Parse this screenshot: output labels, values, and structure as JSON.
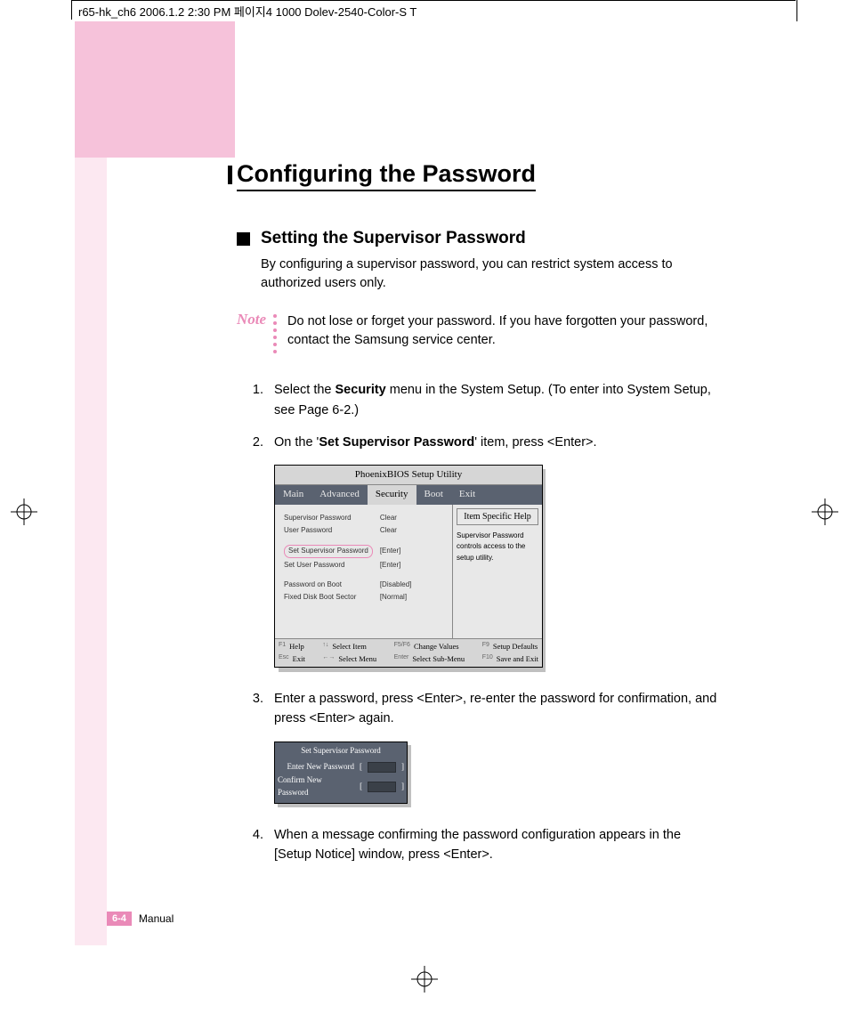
{
  "header": "r65-hk_ch6  2006.1.2 2:30 PM  페이지4   1000 Dolev-2540-Color-S  T",
  "title": "Configuring the Password",
  "section": {
    "title": "Setting the Supervisor Password",
    "body": "By configuring a supervisor password, you can restrict system access to authorized users only."
  },
  "note": {
    "label": "Note",
    "text": "Do not lose or forget your password. If you have forgotten your password, contact the Samsung service center."
  },
  "steps": [
    {
      "num": "1.",
      "pre": "Select the ",
      "bold": "Security",
      "post": " menu in the System Setup. (To enter into System Setup, see Page 6-2.)"
    },
    {
      "num": "2.",
      "pre": "On the '",
      "bold": "Set Supervisor Password",
      "post": "' item, press <Enter>."
    },
    {
      "num": "3.",
      "pre": "",
      "bold": "",
      "post": "Enter a password, press <Enter>, re-enter the password for confirmation, and press <Enter> again."
    },
    {
      "num": "4.",
      "pre": "",
      "bold": "",
      "post": "When a message confirming the password configuration appears in the [Setup Notice] window, press <Enter>."
    }
  ],
  "bios": {
    "title": "PhoenixBIOS  Setup Utility",
    "menu": [
      "Main",
      "Advanced",
      "Security",
      "Boot",
      "Exit"
    ],
    "active_menu": "Security",
    "rows": [
      {
        "label": "Supervisor Password",
        "value": "Clear"
      },
      {
        "label": "User Password",
        "value": "Clear"
      }
    ],
    "rows2": [
      {
        "label": "Set Supervisor Password",
        "value": "[Enter]",
        "highlight": true
      },
      {
        "label": "Set User Password",
        "value": "[Enter]"
      }
    ],
    "rows3": [
      {
        "label": "Password on Boot",
        "value": "[Disabled]"
      },
      {
        "label": "Fixed Disk Boot Sector",
        "value": "[Normal]"
      }
    ],
    "help_title": "Item Specific Help",
    "help_text": "Supervisor Password controls access to the setup utility.",
    "footer": {
      "c1": [
        {
          "k": "F1",
          "v": "Help"
        },
        {
          "k": "Esc",
          "v": "Exit"
        }
      ],
      "c2": [
        {
          "k": "↑↓",
          "v": "Select Item"
        },
        {
          "k": "←→",
          "v": "Select Menu"
        }
      ],
      "c3": [
        {
          "k": "F5/F6",
          "v": "Change Values"
        },
        {
          "k": "Enter",
          "v": "Select Sub-Menu"
        }
      ],
      "c4": [
        {
          "k": "F9",
          "v": "Setup Defaults"
        },
        {
          "k": "F10",
          "v": "Save and Exit"
        }
      ]
    }
  },
  "dialog": {
    "title": "Set Supervisor Password",
    "row1": "Enter New Password",
    "row2": "Confirm New Password",
    "bracket_l": "[",
    "bracket_r": "]"
  },
  "footer": {
    "page": "6-4",
    "label": "Manual"
  }
}
